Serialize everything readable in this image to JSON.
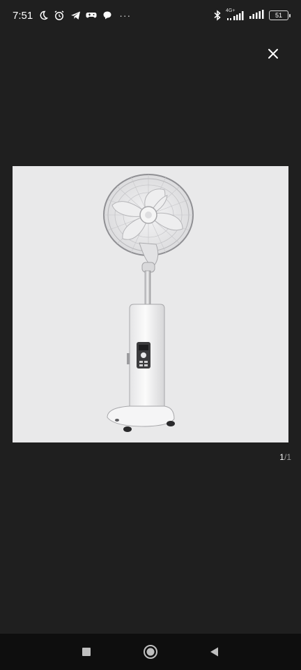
{
  "status_bar": {
    "time": "7:51",
    "network_label": "4G+",
    "battery_level": "51",
    "more_indicator": "···"
  },
  "viewer": {
    "page_current": "1",
    "page_separator": "/",
    "page_total": "1"
  },
  "image": {
    "subject": "white standing pedestal fan with control panel",
    "background_color": "#e9e9ea"
  },
  "icons": {
    "close": "close-icon",
    "moon": "moon-icon",
    "alarm": "alarm-icon",
    "telegram": "telegram-icon",
    "game": "gamepad-icon",
    "chat": "chat-bubble-icon",
    "bluetooth": "bluetooth-icon",
    "signal": "signal-icon",
    "battery": "battery-icon",
    "nav_recent": "square-icon",
    "nav_home": "circle-icon",
    "nav_back": "triangle-back-icon"
  },
  "colors": {
    "background": "#1f1f1f",
    "nav_bar": "#0e0e0e",
    "text": "#ffffff"
  }
}
